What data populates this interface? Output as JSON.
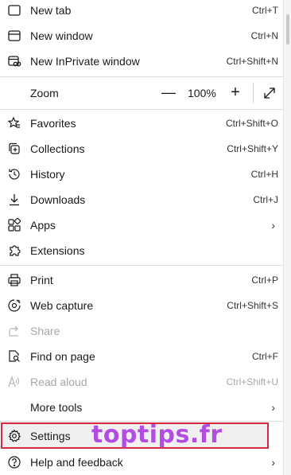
{
  "menu": {
    "new_tab": {
      "label": "New tab",
      "shortcut": "Ctrl+T"
    },
    "new_window": {
      "label": "New window",
      "shortcut": "Ctrl+N"
    },
    "new_inprivate": {
      "label": "New InPrivate window",
      "shortcut": "Ctrl+Shift+N"
    },
    "zoom": {
      "label": "Zoom",
      "minus": "—",
      "value": "100%",
      "plus": "+"
    },
    "favorites": {
      "label": "Favorites",
      "shortcut": "Ctrl+Shift+O"
    },
    "collections": {
      "label": "Collections",
      "shortcut": "Ctrl+Shift+Y"
    },
    "history": {
      "label": "History",
      "shortcut": "Ctrl+H"
    },
    "downloads": {
      "label": "Downloads",
      "shortcut": "Ctrl+J"
    },
    "apps": {
      "label": "Apps",
      "chevron": "›"
    },
    "extensions": {
      "label": "Extensions"
    },
    "print": {
      "label": "Print",
      "shortcut": "Ctrl+P"
    },
    "web_capture": {
      "label": "Web capture",
      "shortcut": "Ctrl+Shift+S"
    },
    "share": {
      "label": "Share"
    },
    "find_on_page": {
      "label": "Find on page",
      "shortcut": "Ctrl+F"
    },
    "read_aloud": {
      "label": "Read aloud",
      "shortcut": "Ctrl+Shift+U"
    },
    "more_tools": {
      "label": "More tools",
      "chevron": "›"
    },
    "settings": {
      "label": "Settings"
    },
    "help": {
      "label": "Help and feedback",
      "chevron": "›"
    }
  },
  "watermark": {
    "text": "toptips.fr"
  },
  "colors": {
    "highlight_border": "#d7263d",
    "watermark": "#b14de0"
  }
}
